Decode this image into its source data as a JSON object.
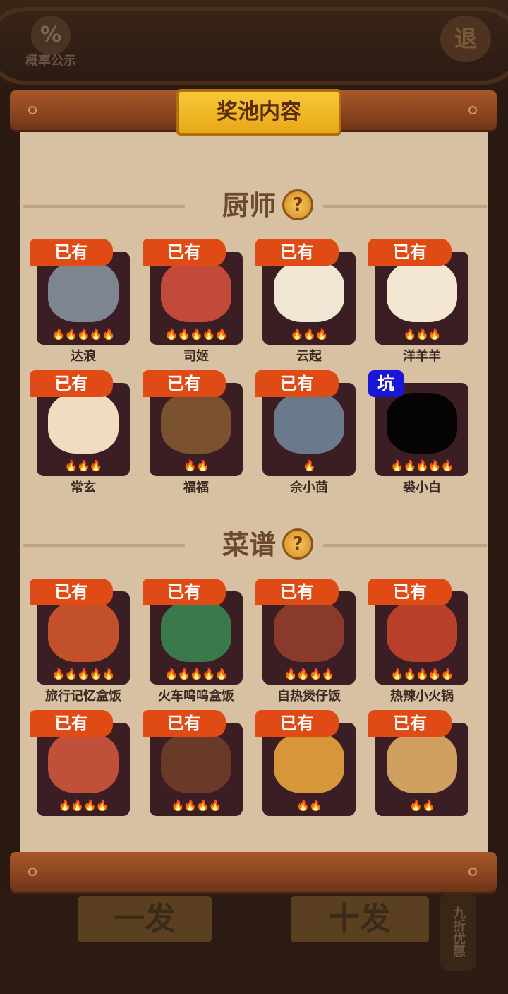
{
  "header": {
    "prob_icon": "%",
    "prob_label": "概率公示",
    "exit_label": "退"
  },
  "panel": {
    "title": "奖池内容"
  },
  "sections": {
    "chefs": {
      "title": "厨师",
      "help_icon": "?"
    },
    "recipes": {
      "title": "菜谱",
      "help_icon": "?"
    }
  },
  "chefs": [
    {
      "name": "达浪",
      "badge": "已有",
      "flames": "🔥🔥🔥🔥🔥",
      "color": "#7d8590"
    },
    {
      "name": "司姬",
      "badge": "已有",
      "flames": "🔥🔥🔥🔥🔥",
      "color": "#c24a3a"
    },
    {
      "name": "云起",
      "badge": "已有",
      "flames": "🔥🔥🔥",
      "color": "#efe6d4"
    },
    {
      "name": "洋羊羊",
      "badge": "已有",
      "flames": "🔥🔥🔥",
      "color": "#f3e7d2"
    },
    {
      "name": "常玄",
      "badge": "已有",
      "flames": "🔥🔥🔥",
      "color": "#f0dcc0"
    },
    {
      "name": "福福",
      "badge": "已有",
      "flames": "🔥🔥",
      "color": "#7a5230"
    },
    {
      "name": "佘小茴",
      "badge": "已有",
      "flames": "🔥",
      "color": "#6a7a8a"
    },
    {
      "name": "裘小白",
      "badge": "坑",
      "badge_type": "blue",
      "flames": "🔥🔥🔥🔥🔥",
      "color": "#050303"
    }
  ],
  "recipes": [
    {
      "name": "旅行记忆盒饭",
      "badge": "已有",
      "flames": "🔥🔥🔥🔥🔥",
      "color": "#c2502a"
    },
    {
      "name": "火车呜呜盒饭",
      "badge": "已有",
      "flames": "🔥🔥🔥🔥🔥",
      "color": "#3a7a4a"
    },
    {
      "name": "自热煲仔饭",
      "badge": "已有",
      "flames": "🔥🔥🔥🔥",
      "color": "#8a3a2a"
    },
    {
      "name": "热辣小火锅",
      "badge": "已有",
      "flames": "🔥🔥🔥🔥🔥",
      "color": "#b8402a"
    },
    {
      "name": "",
      "badge": "已有",
      "flames": "🔥🔥🔥🔥",
      "color": "#c0503a"
    },
    {
      "name": "",
      "badge": "已有",
      "flames": "🔥🔥🔥🔥",
      "color": "#6a3a28"
    },
    {
      "name": "",
      "badge": "已有",
      "flames": "🔥🔥",
      "color": "#d8963a"
    },
    {
      "name": "",
      "badge": "已有",
      "flames": "🔥🔥",
      "color": "#d0a060"
    }
  ],
  "footer": {
    "btn1_label": "一发",
    "btn10_label": "十发",
    "discount_label": "九折优惠"
  }
}
